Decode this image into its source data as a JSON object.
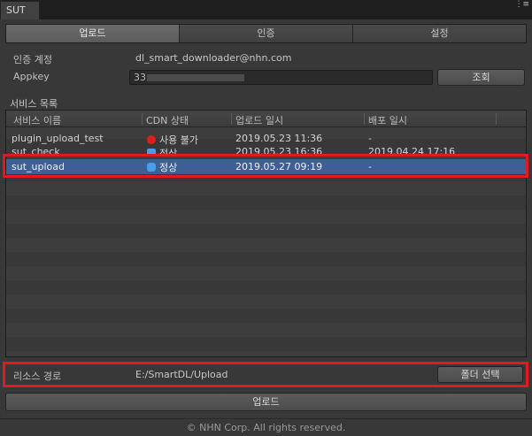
{
  "window": {
    "tab_label": "SUT",
    "menu_glyph": "⋮≡"
  },
  "tabs": [
    {
      "label": "업로드",
      "active": true
    },
    {
      "label": "인증",
      "active": false
    },
    {
      "label": "설정",
      "active": false
    }
  ],
  "auth": {
    "account_label": "인증 계정",
    "account_value": "dl_smart_downloader@nhn.com",
    "appkey_label": "Appkey",
    "appkey_value": "33",
    "lookup_button": "조회"
  },
  "services": {
    "section_label": "서비스 목록",
    "columns": [
      "서비스 이름",
      "CDN 상태",
      "업로드 일시",
      "배포 일시"
    ],
    "rows": [
      {
        "name": "plugin_upload_test",
        "status": "사용 불가",
        "status_color": "#e01c1c",
        "uploaded": "2019.05.23 11:36",
        "deployed": "-"
      },
      {
        "name": "sut_check",
        "status": "정상",
        "status_color": "#4a9be8",
        "uploaded": "2019.05.23 16:36",
        "deployed": "2019.04.24 17:16"
      },
      {
        "name": "sut_upload",
        "status": "정상",
        "status_color": "#4a9be8",
        "uploaded": "2019.05.27 09:19",
        "deployed": "-",
        "selected": true
      }
    ]
  },
  "resource": {
    "label": "리소스 경로",
    "path": "E:/SmartDL/Upload",
    "folder_button": "폴더 선택"
  },
  "upload_button": "업로드",
  "copyright": "© NHN Corp. All rights reserved.",
  "colors": {
    "highlight": "#e2191f",
    "selection": "#3e5f96",
    "status_error": "#e01c1c",
    "status_ok": "#4a9be8"
  }
}
